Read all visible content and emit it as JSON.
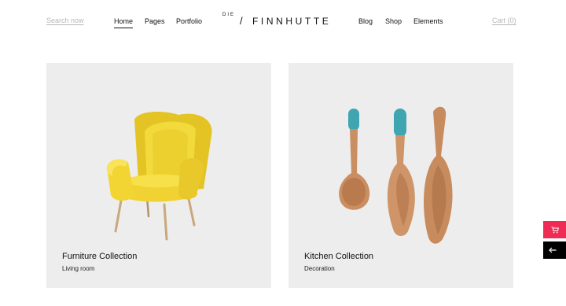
{
  "header": {
    "search_label": "Search now",
    "nav_left": [
      "Home",
      "Pages",
      "Portfolio"
    ],
    "logo": {
      "prefix": "DIE",
      "slash": "/",
      "name": "FINNHUTTE"
    },
    "nav_right": [
      "Blog",
      "Shop",
      "Elements"
    ],
    "cart_label": "Cart (0)",
    "active_nav": "Home"
  },
  "cards": [
    {
      "title": "Furniture Collection",
      "subtitle": "Living room"
    },
    {
      "title": "Kitchen Collection",
      "subtitle": "Decoration"
    }
  ],
  "side_widgets": {
    "cart_icon": "cart-icon",
    "back_icon": "arrow-left-icon"
  },
  "colors": {
    "accent": "#ef2c55",
    "chair_yellow": "#f0d232",
    "spoon_teal": "#3fa5b0",
    "wood": "#c98e62"
  }
}
